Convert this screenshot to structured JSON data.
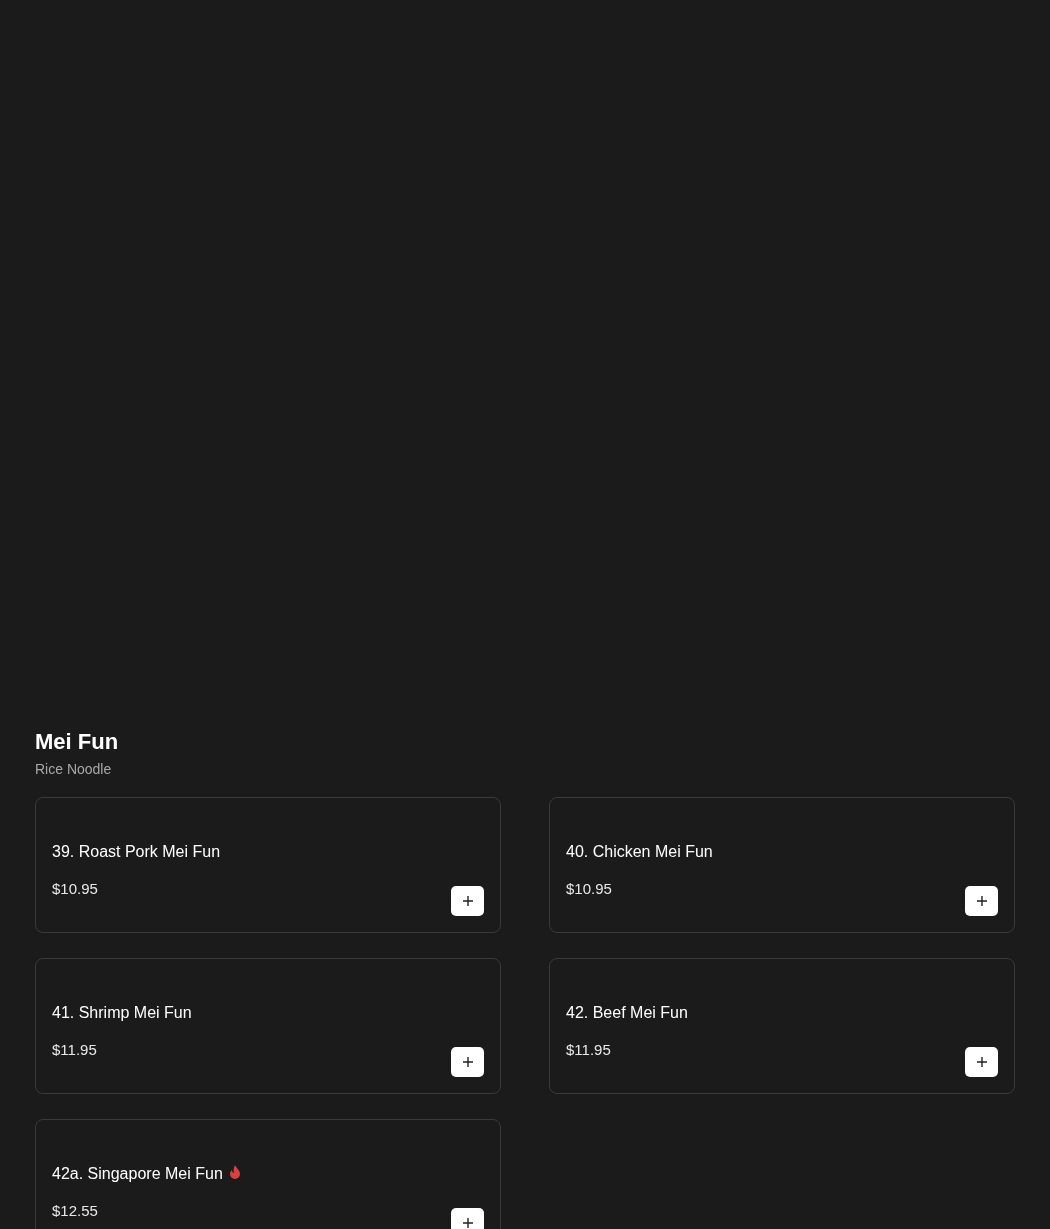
{
  "section": {
    "title": "Mei Fun",
    "subtitle": "Rice Noodle"
  },
  "items": [
    {
      "name": "39. Roast Pork Mei Fun",
      "price": "$10.95",
      "spicy": false
    },
    {
      "name": "40. Chicken Mei Fun",
      "price": "$10.95",
      "spicy": false
    },
    {
      "name": "41. Shrimp Mei Fun",
      "price": "$11.95",
      "spicy": false
    },
    {
      "name": "42. Beef Mei Fun",
      "price": "$11.95",
      "spicy": false
    },
    {
      "name": "42a. Singapore Mei Fun",
      "price": "$12.55",
      "spicy": true
    }
  ]
}
